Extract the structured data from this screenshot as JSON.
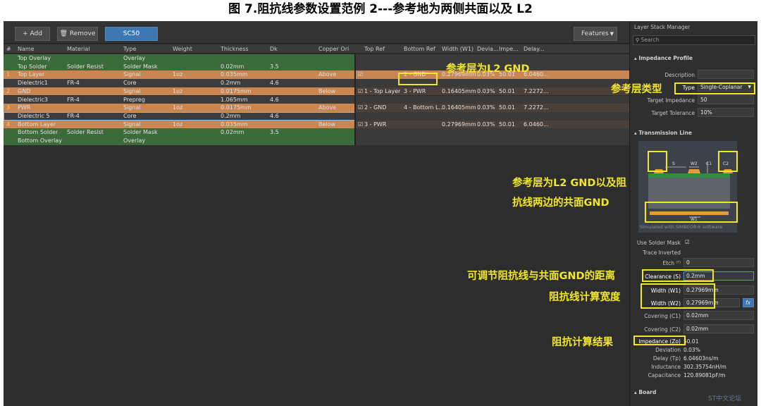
{
  "caption": "图 7.阻抗线参数设置范例 2---参考地为两侧共面以及 L2",
  "toolbar": {
    "add": "+ Add",
    "remove": "🗑 Remove",
    "sc": "SC50",
    "features": "Features"
  },
  "headers": [
    "#",
    "Name",
    "Material",
    "Type",
    "Weight",
    "Thickness",
    "Dk",
    "Copper Ori",
    "Top Ref",
    "Bottom Ref",
    "Width (W1)",
    "Devia...",
    "Impe...",
    "Delay..."
  ],
  "rows": [
    {
      "num": "",
      "name": "Top Overlay",
      "material": "",
      "type": "Overlay",
      "weight": "",
      "thick": "",
      "dk": "",
      "orient": "",
      "check": "",
      "topref": "",
      "botref": "",
      "width": "",
      "dev": "",
      "imp": "",
      "delay": "",
      "kind": "overlay"
    },
    {
      "num": "",
      "name": "Top Solder",
      "material": "Solder Resist",
      "type": "Solder Mask",
      "weight": "",
      "thick": "0.02mm",
      "dk": "3.5",
      "orient": "",
      "check": "",
      "topref": "",
      "botref": "",
      "width": "",
      "dev": "",
      "imp": "",
      "delay": "",
      "kind": "overlay"
    },
    {
      "num": "1",
      "name": "Top Layer",
      "material": "",
      "type": "Signal",
      "weight": "1oz",
      "thick": "0.035mm",
      "dk": "",
      "orient": "Above",
      "check": "☑",
      "topref": "",
      "botref": "2 - GND",
      "width": "0.27969mm",
      "dev": "0.03%",
      "imp": "50.01",
      "delay": "6.0460...",
      "kind": "signal"
    },
    {
      "num": "",
      "name": "Dielectric1",
      "material": "FR-4",
      "type": "Core",
      "weight": "",
      "thick": "0.2mm",
      "dk": "4.6",
      "orient": "",
      "check": "",
      "topref": "",
      "botref": "",
      "width": "",
      "dev": "",
      "imp": "",
      "delay": "",
      "kind": "diel"
    },
    {
      "num": "2",
      "name": "GND",
      "material": "",
      "type": "Signal",
      "weight": "1oz",
      "thick": "0.0175mm",
      "dk": "",
      "orient": "Below",
      "check": "☑",
      "topref": "1 - Top Layer",
      "botref": "3 - PWR",
      "width": "0.16405mm",
      "dev": "0.03%",
      "imp": "50.01",
      "delay": "7.2272...",
      "kind": "signal"
    },
    {
      "num": "",
      "name": "Dielectric3",
      "material": "FR-4",
      "type": "Prepreg",
      "weight": "",
      "thick": "1.065mm",
      "dk": "4.6",
      "orient": "",
      "check": "",
      "topref": "",
      "botref": "",
      "width": "",
      "dev": "",
      "imp": "",
      "delay": "",
      "kind": "diel"
    },
    {
      "num": "3",
      "name": "PWR",
      "material": "",
      "type": "Signal",
      "weight": "1oz",
      "thick": "0.0175mm",
      "dk": "",
      "orient": "Above",
      "check": "☑",
      "topref": "2 - GND",
      "botref": "4 - Bottom L...",
      "width": "0.16405mm",
      "dev": "0.03%",
      "imp": "50.01",
      "delay": "7.2272...",
      "kind": "signal"
    },
    {
      "num": "",
      "name": "Dielectric 5",
      "material": "FR-4",
      "type": "Core",
      "weight": "",
      "thick": "0.2mm",
      "dk": "4.6",
      "orient": "",
      "check": "",
      "topref": "",
      "botref": "",
      "width": "",
      "dev": "",
      "imp": "",
      "delay": "",
      "kind": "diel"
    },
    {
      "num": "4",
      "name": "Bottom Layer",
      "material": "",
      "type": "Signal",
      "weight": "1oz",
      "thick": "0.035mm",
      "dk": "",
      "orient": "Below",
      "check": "☑",
      "topref": "3 - PWR",
      "botref": "",
      "width": "0.27969mm",
      "dev": "0.03%",
      "imp": "50.01",
      "delay": "6.0460...",
      "kind": "signal"
    },
    {
      "num": "",
      "name": "Bottom Solder",
      "material": "Solder Resist",
      "type": "Solder Mask",
      "weight": "",
      "thick": "0.02mm",
      "dk": "3.5",
      "orient": "",
      "check": "",
      "topref": "",
      "botref": "",
      "width": "",
      "dev": "",
      "imp": "",
      "delay": "",
      "kind": "overlay"
    },
    {
      "num": "",
      "name": "Bottom Overlay",
      "material": "",
      "type": "Overlay",
      "weight": "",
      "thick": "",
      "dk": "",
      "orient": "",
      "check": "",
      "topref": "",
      "botref": "",
      "width": "",
      "dev": "",
      "imp": "",
      "delay": "",
      "kind": "overlay"
    }
  ],
  "panel": {
    "title": "Layer Stack Manager",
    "search_placeholder": "Search",
    "impedance_profile": "▴ Impedance Profile",
    "description_label": "Description",
    "type_label": "Type",
    "type_value": "Single-Coplanar",
    "target_imp_label": "Target Impedance",
    "target_imp_value": "50",
    "target_tol_label": "Target Tolerance",
    "target_tol_value": "10%",
    "transmission_line": "▴ Transmission Line",
    "diag_s": "S",
    "diag_w2": "W2",
    "diag_c1": "C1",
    "diag_c2": "C2",
    "diag_w1": "W1",
    "simulated": "Simulated with SIMBEOR® software",
    "use_solder_mask": "Use Solder Mask",
    "trace_inverted": "Trace Inverted",
    "etch_label": "Etch ⁽ᵀ⁾",
    "etch_value": "0",
    "clearance_label": "Clearance (S)",
    "clearance_value": "0.2mm",
    "w1_label": "Width (W1)",
    "w1_value": "0.27969mm",
    "w2_label": "Width (W2)",
    "w2_value": "0.27969mm",
    "fx": "fx",
    "c1_label": "Covering (C1)",
    "c1_value": "0.02mm",
    "c2_label": "Covering (C2)",
    "c2_value": "0.02mm",
    "imp_label": "Impedance (Zo)",
    "imp_value": "50.01",
    "dev_label": "Deviation",
    "dev_value": "0.03%",
    "delay_label": "Delay (Tp)",
    "delay_value": "6.04603ns/m",
    "ind_label": "Inductance",
    "ind_value": "302.35754nH/m",
    "cap_label": "Capacitance",
    "cap_value": "120.89081pF/m",
    "board": "▴ Board"
  },
  "annotations": {
    "ref_l2": "参考层为L2 GND",
    "ref_type": "参考层类型",
    "ref_desc_1": "参考层为L2 GND以及阻",
    "ref_desc_2": "抗线两边的共面GND",
    "clearance": "可调节阻抗线与共面GND的距离",
    "width": "阻抗线计算宽度",
    "result": "阻抗计算结果"
  },
  "watermark": "ST中文论坛",
  "colors": {
    "overlay": "#3b6b3b",
    "signal": "#c98651",
    "dielectric": "#444040",
    "highlight": "#f3e626",
    "accent": "#3d78b4"
  }
}
